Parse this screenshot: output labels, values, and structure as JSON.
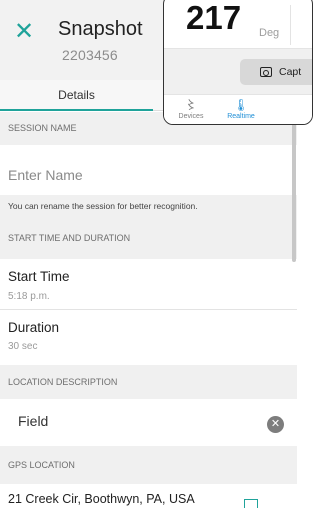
{
  "header": {
    "close_glyph": "✕",
    "title": "Snapshot",
    "subtitle": "2203456"
  },
  "tabs": [
    {
      "label": "Details",
      "active": true
    }
  ],
  "session": {
    "section_title": "SESSION NAME",
    "name_placeholder": "Enter Name",
    "hint": "You can rename the session for better recognition."
  },
  "timing": {
    "section_title": "START TIME AND DURATION",
    "start_label": "Start Time",
    "start_value": "5:18 p.m.",
    "duration_label": "Duration",
    "duration_value": "30 sec"
  },
  "location": {
    "section_title": "LOCATION DESCRIPTION",
    "value": "Field",
    "clear_glyph": "✕"
  },
  "gps": {
    "section_title": "GPS LOCATION",
    "address": "21 Creek Cir, Boothwyn, PA, USA"
  },
  "overlay": {
    "reading": "217",
    "unit": "Deg",
    "capture_label": "Capt",
    "nav": [
      {
        "label": "Devices",
        "icon": "device-wave-icon",
        "glyph": "〻",
        "active": false
      },
      {
        "label": "Realtime",
        "icon": "thermometer-icon",
        "glyph": "🌡",
        "active": true
      }
    ]
  },
  "colors": {
    "accent": "#1fa39a",
    "header_bg": "#f2f2f2",
    "section_bg": "#f0f0f0"
  }
}
